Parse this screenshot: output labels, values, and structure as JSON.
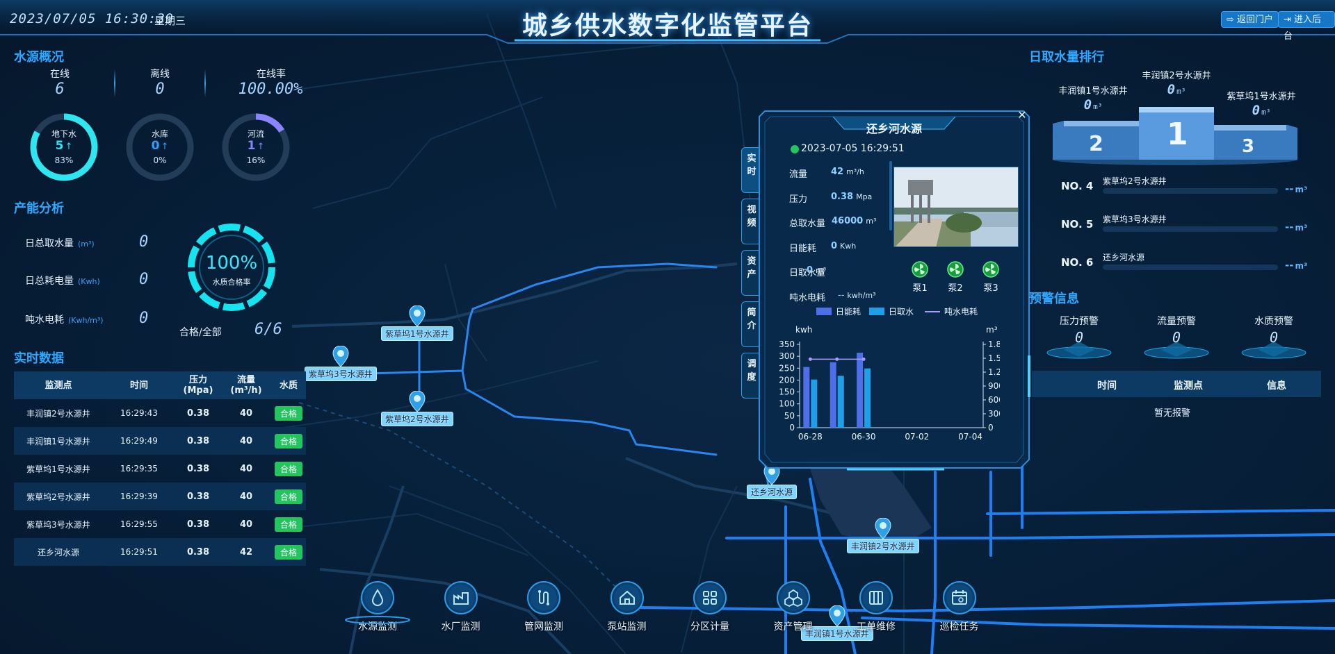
{
  "header": {
    "datetime": "2023/07/05 16:30:39",
    "weekday": "星期三",
    "title": "城乡供水数字化监管平台",
    "btn_portal": "返回门户",
    "btn_backend": "进入后台"
  },
  "water_overview": {
    "title": "水源概况",
    "online_label": "在线",
    "online": "6",
    "offline_label": "离线",
    "offline": "0",
    "rate_label": "在线率",
    "rate": "100.00%",
    "rings": [
      {
        "name": "地下水",
        "count": "5",
        "arrow": "↑",
        "pct": "83%",
        "ratio": 0.83,
        "color": "#2ee6f0"
      },
      {
        "name": "水库",
        "count": "0",
        "arrow": "↑",
        "pct": "0%",
        "ratio": 0,
        "color": "#2aa3ff"
      },
      {
        "name": "河流",
        "count": "1",
        "arrow": "↑",
        "pct": "16%",
        "ratio": 0.16,
        "color": "#8b84ff"
      }
    ]
  },
  "capacity": {
    "title": "产能分析",
    "rows": [
      {
        "label": "日总取水量",
        "unit": "(m³)",
        "value": "0"
      },
      {
        "label": "日总耗电量",
        "unit": "(Kwh)",
        "value": "0"
      },
      {
        "label": "吨水电耗",
        "unit": "(Kwh/m³)",
        "value": "0"
      }
    ],
    "quality_pct": "100%",
    "quality_label": "水质合格率",
    "pass_label": "合格/全部",
    "pass_value": "6/6"
  },
  "realtime": {
    "title": "实时数据",
    "headers": [
      "监测点",
      "时间",
      "压力\n(Mpa)",
      "流量\n(m³/h)",
      "水质"
    ],
    "rows": [
      [
        "丰润镇2号水源井",
        "16:29:43",
        "0.38",
        "40",
        "合格"
      ],
      [
        "丰润镇1号水源井",
        "16:29:49",
        "0.38",
        "40",
        "合格"
      ],
      [
        "紫草坞1号水源井",
        "16:29:35",
        "0.38",
        "40",
        "合格"
      ],
      [
        "紫草坞2号水源井",
        "16:29:39",
        "0.38",
        "40",
        "合格"
      ],
      [
        "紫草坞3号水源井",
        "16:29:55",
        "0.38",
        "40",
        "合格"
      ],
      [
        "还乡河水源",
        "16:29:51",
        "0.38",
        "42",
        "合格"
      ]
    ]
  },
  "map_pins": [
    "紫草坞1号水源井",
    "紫草坞3号水源井",
    "紫草坞2号水源井",
    "还乡河水源",
    "丰润镇2号水源井",
    "丰润镇1号水源井"
  ],
  "popup": {
    "title": "还乡河水源",
    "close": "✕",
    "tabs": [
      "实时",
      "视频",
      "资产",
      "简介",
      "调度"
    ],
    "time": "2023-07-05 16:29:51",
    "metrics": [
      {
        "label": "流量",
        "value": "42",
        "unit": "m³/h"
      },
      {
        "label": "压力",
        "value": "0.38",
        "unit": "Mpa"
      },
      {
        "label": "总取水量",
        "value": "46000",
        "unit": "m³"
      },
      {
        "label": "日能耗",
        "value": "0",
        "unit": "Kwh"
      },
      {
        "label": "日取水量",
        "value": "0",
        "unit": "m³"
      },
      {
        "label": "吨水电耗",
        "value": "--",
        "unit": "kwh/m³"
      }
    ],
    "pumps": [
      "泵1",
      "泵2",
      "泵3"
    ],
    "legend": [
      "日能耗",
      "日取水",
      "吨水电耗"
    ],
    "left_unit": "kwh",
    "right_unit": "m³"
  },
  "chart_data": {
    "type": "bar",
    "categories": [
      "06-28",
      "06-29",
      "06-30",
      "07-01",
      "07-02",
      "07-03",
      "07-04"
    ],
    "xtick_labels": [
      "06-28",
      "06-30",
      "07-02",
      "07-04"
    ],
    "series": [
      {
        "name": "日能耗",
        "axis": "left",
        "values": [
          255,
          275,
          315,
          null,
          null,
          null,
          null
        ],
        "color": "#4f6fe8"
      },
      {
        "name": "日取水",
        "axis": "right",
        "values": [
          1040,
          1120,
          1280,
          null,
          null,
          null,
          null
        ],
        "color": "#1f9fe8"
      },
      {
        "name": "吨水电耗",
        "axis": "right",
        "type": "line",
        "values": [
          1480,
          1480,
          1480,
          null,
          null,
          null,
          null
        ],
        "color": "#a89cff"
      }
    ],
    "ylim_left": [
      0,
      350
    ],
    "yticks_left": [
      "0",
      "50",
      "100",
      "150",
      "200",
      "250",
      "300",
      "350"
    ],
    "ylim_right": [
      0,
      1800
    ],
    "yticks_right": [
      "0",
      "300",
      "600",
      "900",
      "1.2k",
      "1.5k",
      "1.8k"
    ],
    "ylabel_left": "kwh",
    "ylabel_right": "m³"
  },
  "ranking": {
    "title": "日取水量排行",
    "podium": [
      {
        "rank": "1",
        "name": "丰润镇2号水源井",
        "value": "0",
        "unit": "m³"
      },
      {
        "rank": "2",
        "name": "丰润镇1号水源井",
        "value": "0",
        "unit": "m³"
      },
      {
        "rank": "3",
        "name": "紫草坞1号水源井",
        "value": "0",
        "unit": "m³"
      }
    ],
    "list": [
      {
        "no": "NO. 4",
        "name": "紫草坞2号水源井",
        "value": "--",
        "unit": "m³"
      },
      {
        "no": "NO. 5",
        "name": "紫草坞3号水源井",
        "value": "--",
        "unit": "m³"
      },
      {
        "no": "NO. 6",
        "name": "还乡河水源",
        "value": "--",
        "unit": "m³"
      }
    ]
  },
  "warning": {
    "title": "预警信息",
    "items": [
      {
        "label": "压力预警",
        "value": "0"
      },
      {
        "label": "流量预警",
        "value": "0"
      },
      {
        "label": "水质预警",
        "value": "0"
      }
    ],
    "headers": [
      "时间",
      "监测点",
      "信息"
    ],
    "empty": "暂无报警"
  },
  "nav": [
    "水源监测",
    "水厂监测",
    "管网监测",
    "泵站监测",
    "分区计量",
    "资产管理",
    "工单维修",
    "巡检任务"
  ]
}
